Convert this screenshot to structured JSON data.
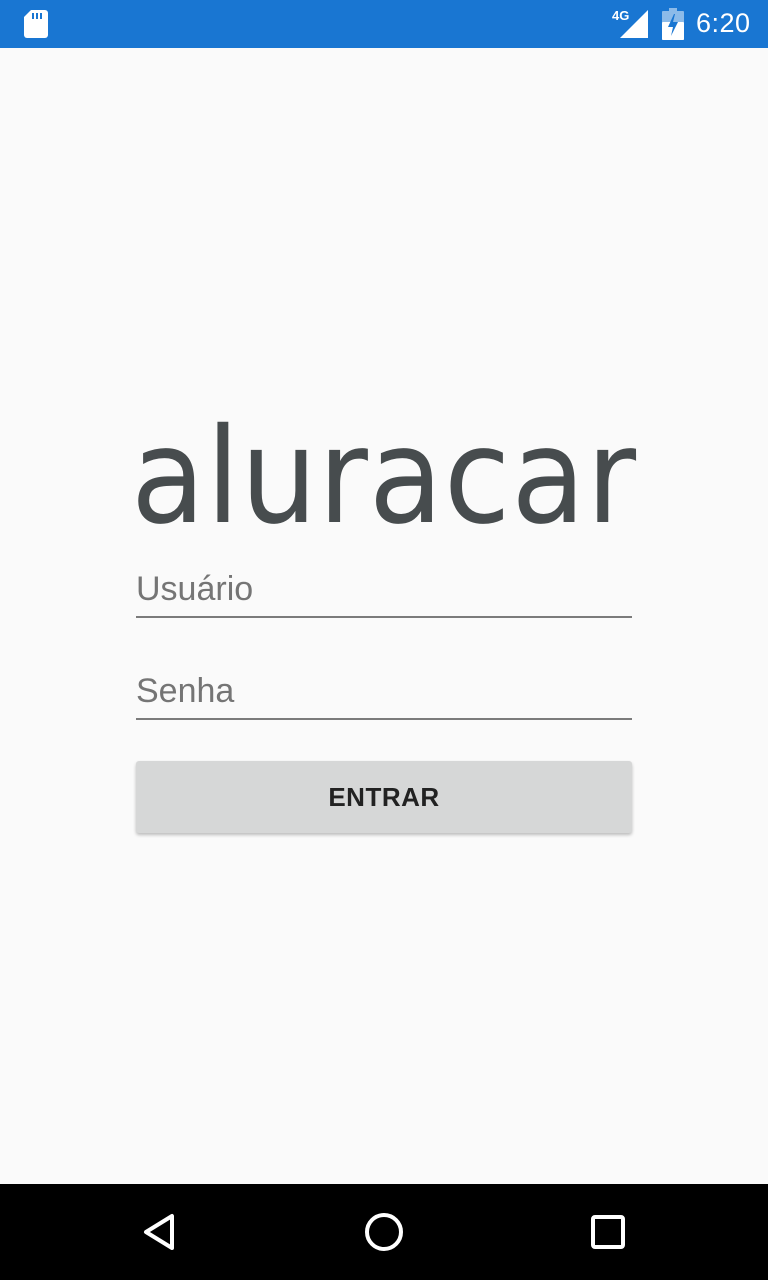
{
  "status_bar": {
    "network_type": "4G",
    "time": "6:20",
    "icons": [
      "sd-card-icon",
      "signal-icon",
      "battery-icon"
    ]
  },
  "app": {
    "logo_text": "aluracar"
  },
  "login_form": {
    "username": {
      "value": "",
      "placeholder": "Usuário"
    },
    "password": {
      "value": "",
      "placeholder": "Senha"
    },
    "submit_label": "ENTRAR"
  },
  "nav_bar": {
    "buttons": [
      "back-icon",
      "home-icon",
      "recents-icon"
    ]
  },
  "colors": {
    "status_bar": "#1976d2",
    "background": "#fafafa",
    "logo": "#474c4e",
    "button": "#d6d7d7",
    "nav_bar": "#000000"
  }
}
